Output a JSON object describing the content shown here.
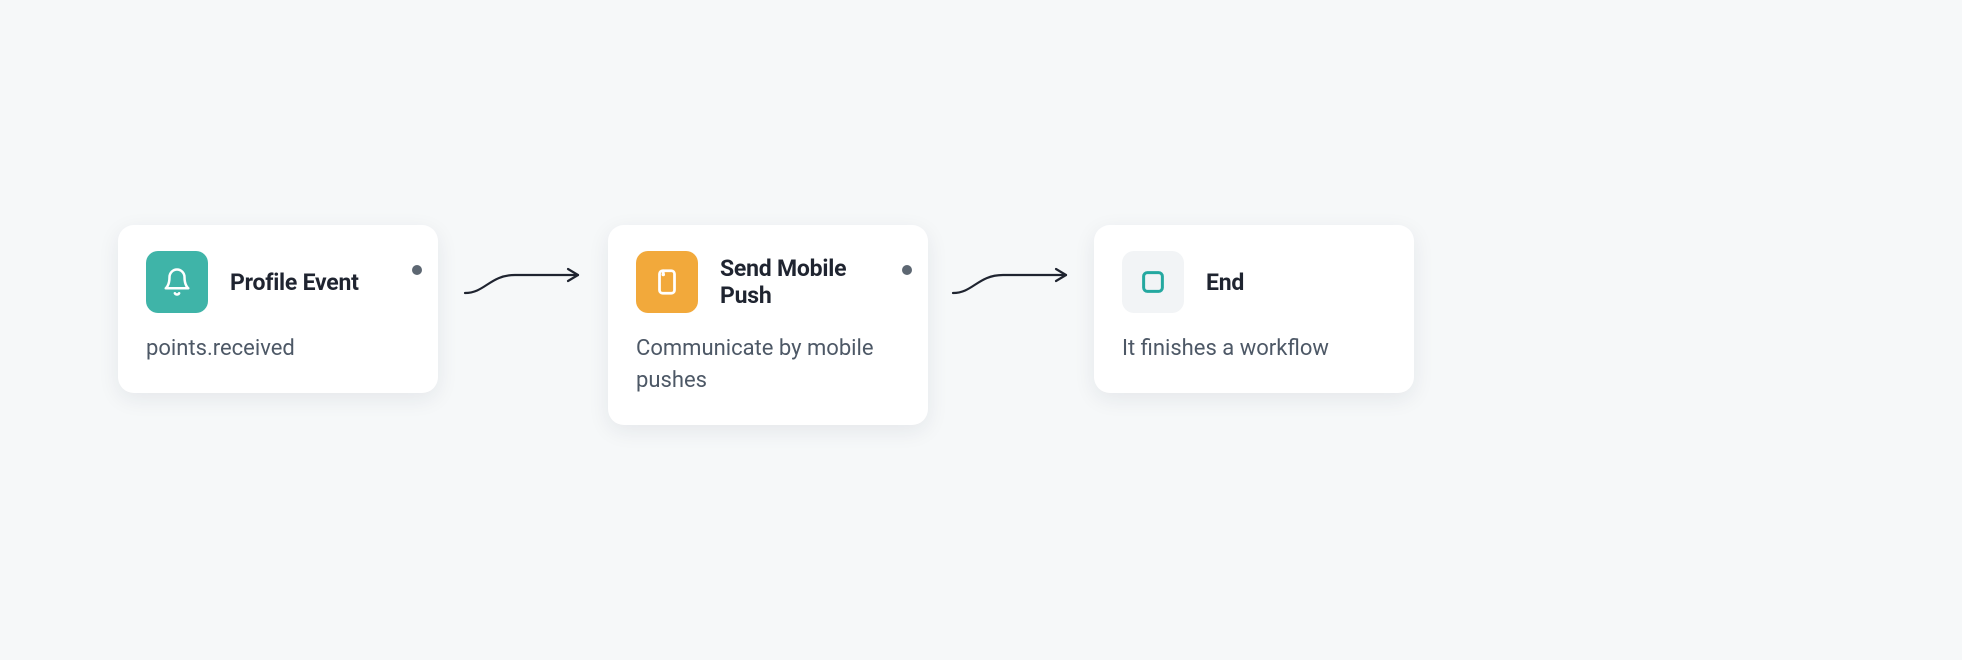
{
  "workflow": {
    "nodes": {
      "profile_event": {
        "title": "Profile Event",
        "description": "points.received",
        "icon": "bell-icon",
        "tile_color": "teal",
        "has_status_dot": true
      },
      "send_push": {
        "title": "Send Mobile Push",
        "description": "Communicate by mobile pushes",
        "icon": "device-icon",
        "tile_color": "orange",
        "has_status_dot": true
      },
      "end": {
        "title": "End",
        "description": "It finishes a workflow",
        "icon": "square-icon",
        "tile_color": "grey",
        "has_status_dot": false
      }
    }
  }
}
